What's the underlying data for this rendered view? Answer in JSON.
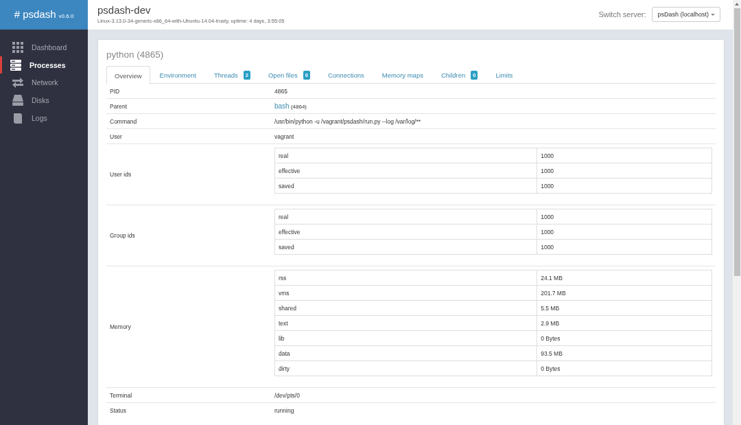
{
  "sidebar": {
    "brand": "# psdash",
    "version": "v0.6.0",
    "items": [
      {
        "label": "Dashboard",
        "selected": false
      },
      {
        "label": "Processes",
        "selected": true
      },
      {
        "label": "Network",
        "selected": false
      },
      {
        "label": "Disks",
        "selected": false
      },
      {
        "label": "Logs",
        "selected": false
      }
    ]
  },
  "header": {
    "title": "psdash-dev",
    "subtitle": "Linux-3.13.0-34-generic-x86_64-with-Ubuntu-14.04-trusty, uptime: 4 days, 3:55:05",
    "switch_label": "Switch server:",
    "server": "psDash (localhost)"
  },
  "process": {
    "title": "python (4865)",
    "tabs": [
      {
        "label": "Overview",
        "selected": true
      },
      {
        "label": "Environment",
        "selected": false
      },
      {
        "label": "Threads",
        "badge": "2",
        "selected": false
      },
      {
        "label": "Open files",
        "badge": "0",
        "selected": false
      },
      {
        "label": "Connections",
        "selected": false
      },
      {
        "label": "Memory maps",
        "selected": false
      },
      {
        "label": "Children",
        "badge": "0",
        "selected": false
      },
      {
        "label": "Limits",
        "selected": false
      }
    ],
    "rows": [
      {
        "kind": "text",
        "label": "PID",
        "value": "4865"
      },
      {
        "kind": "link",
        "label": "Parent",
        "link": "bash",
        "value": "(4864)"
      },
      {
        "kind": "text",
        "label": "Command",
        "value": "/usr/bin/python -u /vagrant/psdash/run.py --log /var/log/**"
      },
      {
        "kind": "text",
        "label": "User",
        "value": "vagrant"
      },
      {
        "kind": "table",
        "label": "User ids",
        "rows": [
          {
            "name": "real",
            "value": "1000"
          },
          {
            "name": "effective",
            "value": "1000"
          },
          {
            "name": "saved",
            "value": "1000"
          }
        ]
      },
      {
        "kind": "table",
        "label": "Group ids",
        "rows": [
          {
            "name": "real",
            "value": "1000"
          },
          {
            "name": "effective",
            "value": "1000"
          },
          {
            "name": "saved",
            "value": "1000"
          }
        ]
      },
      {
        "kind": "table",
        "label": "Memory",
        "rows": [
          {
            "name": "rss",
            "value": "24.1 MB"
          },
          {
            "name": "vms",
            "value": "201.7 MB"
          },
          {
            "name": "shared",
            "value": "5.5 MB"
          },
          {
            "name": "text",
            "value": "2.9 MB"
          },
          {
            "name": "lib",
            "value": "0 Bytes"
          },
          {
            "name": "data",
            "value": "93.5 MB"
          },
          {
            "name": "dirty",
            "value": "0 Bytes"
          }
        ]
      },
      {
        "kind": "text",
        "label": "Terminal",
        "value": "/dev/pts/0"
      },
      {
        "kind": "text",
        "label": "Status",
        "value": "running"
      }
    ]
  }
}
